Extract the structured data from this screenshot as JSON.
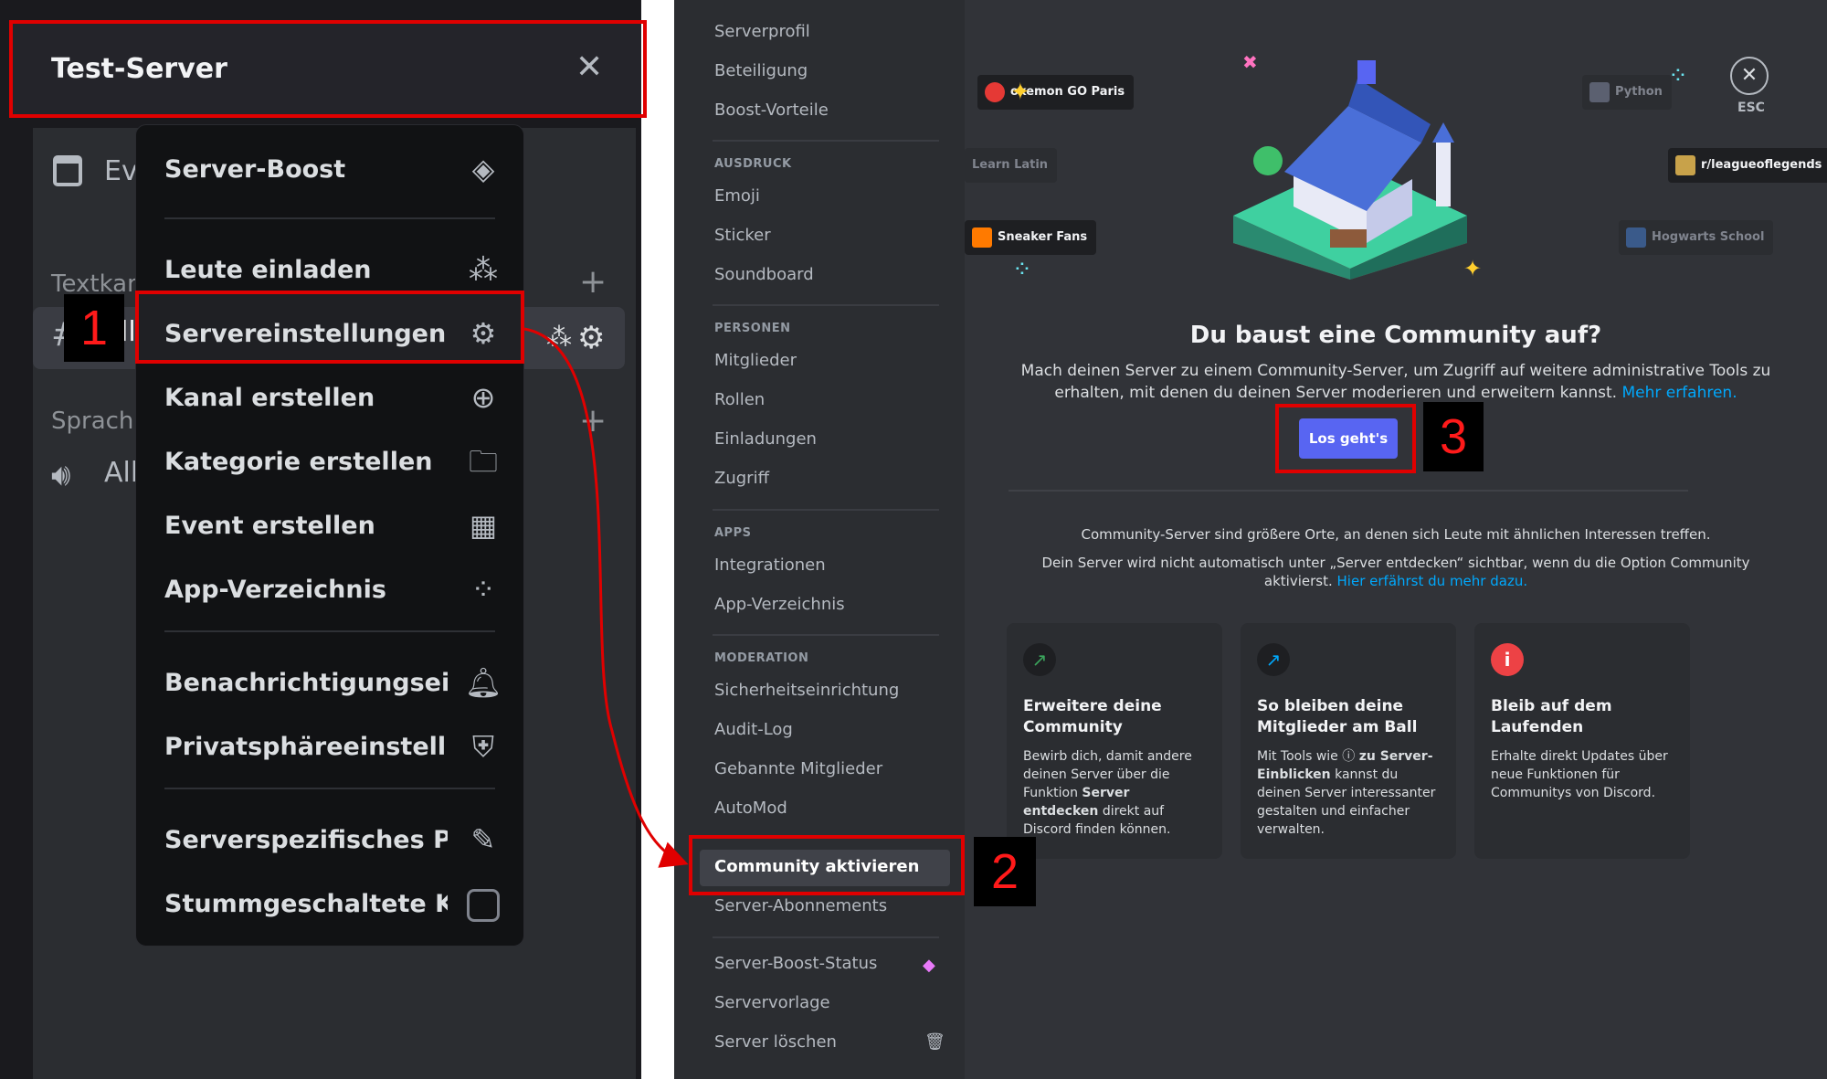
{
  "left": {
    "server_title": "Test-Server",
    "events_label": "Ev",
    "text_category": "Textkan",
    "channel_name": "ll",
    "voice_category": "Sprachk",
    "voice_channel": "All",
    "menu": {
      "server_boost": "Server-Boost",
      "invite": "Leute einladen",
      "settings": "Servereinstellungen",
      "create_channel": "Kanal erstellen",
      "create_category": "Kategorie erstellen",
      "create_event": "Event erstellen",
      "app_directory": "App-Verzeichnis",
      "notifications": "Benachrichtigungseinstellu",
      "privacy": "Privatsphäreeinstellungen",
      "server_profile": "Serverspezifisches Profi...",
      "muted_channels": "Stummgeschaltete Kanä..."
    }
  },
  "sidebar": {
    "top": [
      "Serverprofil",
      "Beteiligung",
      "Boost-Vorteile"
    ],
    "ausdruck_header": "AUSDRUCK",
    "ausdruck": [
      "Emoji",
      "Sticker",
      "Soundboard"
    ],
    "personen_header": "PERSONEN",
    "personen": [
      "Mitglieder",
      "Rollen",
      "Einladungen",
      "Zugriff"
    ],
    "apps_header": "APPS",
    "apps": [
      "Integrationen",
      "App-Verzeichnis"
    ],
    "moderation_header": "MODERATION",
    "moderation": [
      "Sicherheitseinrichtung",
      "Audit-Log",
      "Gebannte Mitglieder",
      "AutoMod"
    ],
    "community": "Community aktivieren",
    "subscriptions": "Server-Abonnements",
    "bottom": [
      "Server-Boost-Status",
      "Servervorlage",
      "Server löschen"
    ]
  },
  "content": {
    "tags": {
      "pokemon": "okemon GO Paris",
      "latin": "Learn Latin",
      "sneaker": "Sneaker Fans",
      "python": "Python",
      "league": "r/leagueoflegends",
      "hogwarts": "Hogwarts School"
    },
    "esc_label": "ESC",
    "headline": "Du baust eine Community auf?",
    "description": "Mach deinen Server zu einem Community-Server, um Zugriff auf weitere administrative Tools zu erhalten, mit denen du deinen Server moderieren und erweitern kannst.",
    "learn_more": "Mehr erfahren.",
    "button": "Los geht's",
    "info1": "Community-Server sind größere Orte, an denen sich Leute mit ähnlichen Interessen treffen.",
    "info2": "Dein Server wird nicht automatisch unter „Server entdecken“ sichtbar, wenn du die Option Community aktivierst.",
    "info2_link": "Hier erfährst du mehr dazu.",
    "cards": [
      {
        "title": "Erweitere deine Community",
        "body_a": "Bewirb dich, damit andere deinen Server über die Funktion ",
        "body_b": "Server entdecken",
        "body_c": " direkt auf Discord finden können."
      },
      {
        "title": "So bleiben deine Mitglieder am Ball",
        "body_a": "Mit Tools wie ",
        "body_b": "zu Server-Einblicken",
        "body_c": " kannst du deinen Server interessanter gestalten und einfacher verwalten."
      },
      {
        "title": "Bleib auf dem Laufenden",
        "body": "Erhalte direkt Updates über neue Funktionen für Communitys von Discord."
      }
    ]
  },
  "annotations": {
    "step1": "1",
    "step2": "2",
    "step3": "3"
  },
  "colors": {
    "annotation_red": "#e00000",
    "blurple": "#5865f2",
    "link": "#00a8fc"
  }
}
